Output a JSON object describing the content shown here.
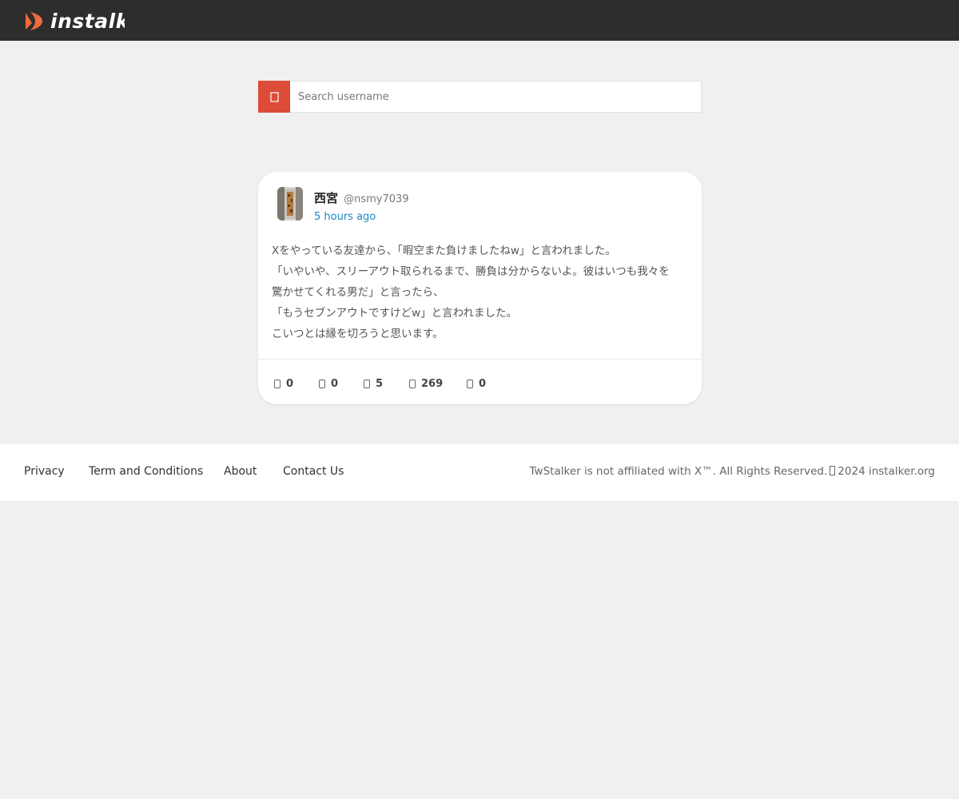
{
  "header": {
    "logo_icon": "instalker-logo-icon",
    "logo_text": "instalker",
    "accent_color": "#ef6a3d"
  },
  "search": {
    "icon": "search-icon",
    "button_color": "#dd4b39",
    "placeholder": "Search username"
  },
  "tweet": {
    "avatar_icon": "avatar-image",
    "author_name": "西宮",
    "author_handle": "@nsmy7039",
    "time": "5 hours ago",
    "lines": [
      "Xをやっている友達から、「暇空また負けましたねw」と言われました。",
      "「いやいや、スリーアウト取られるまで、勝負は分からないよ。彼はいつも我々を",
      "驚かせてくれる男だ」と言ったら、",
      "「もうセブンアウトですけどw」と言われました。",
      "こいつとは縁を切ろうと思います。"
    ],
    "stats": [
      {
        "icon": "reply-icon",
        "value": "0"
      },
      {
        "icon": "retweet-icon",
        "value": "0"
      },
      {
        "icon": "like-icon",
        "value": "5"
      },
      {
        "icon": "views-icon",
        "value": "269"
      },
      {
        "icon": "bookmark-icon",
        "value": "0"
      }
    ]
  },
  "footer": {
    "links": [
      "Privacy",
      "Term and Conditions",
      "About",
      "Contact Us"
    ],
    "copyright_prefix": "TwStalker is not affiliated with X™. All Rights Reserved.",
    "copyright_suffix": "2024 instalker.org"
  }
}
